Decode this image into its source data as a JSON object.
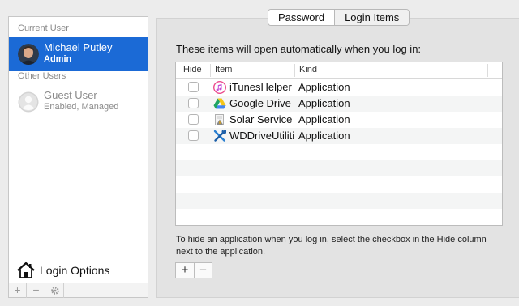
{
  "sidebar": {
    "current_user_header": "Current User",
    "current_user": {
      "name": "Michael Putley",
      "role": "Admin"
    },
    "other_users_header": "Other Users",
    "other_users": [
      {
        "name": "Guest User",
        "role": "Enabled, Managed"
      }
    ],
    "login_options_label": "Login Options",
    "bottom_buttons": {
      "add": "+",
      "remove": "−",
      "action": "gear"
    }
  },
  "tabs": [
    {
      "label": "Password",
      "active": true
    },
    {
      "label": "Login Items",
      "active": false
    }
  ],
  "login_items": {
    "intro": "These items will open automatically when you log in:",
    "columns": {
      "hide": "Hide",
      "item": "Item",
      "kind": "Kind"
    },
    "rows": [
      {
        "name": "iTunesHelper",
        "kind": "Application",
        "hidden": false,
        "icon": "itunes-icon"
      },
      {
        "name": "Google Drive",
        "kind": "Application",
        "hidden": false,
        "icon": "google-drive-icon"
      },
      {
        "name": "Solar Service",
        "kind": "Application",
        "hidden": false,
        "icon": "solar-service-icon"
      },
      {
        "name": "WDDriveUtilities",
        "kind": "Application",
        "hidden": false,
        "icon": "wd-utilities-icon"
      }
    ],
    "hint": "To hide an application when you log in, select the checkbox in the Hide column next to the application.",
    "add_label": "+",
    "remove_label": "−"
  },
  "colors": {
    "selection": "#1b6ad6",
    "panel_background": "#e3e3e3",
    "window_background": "#ececec"
  }
}
